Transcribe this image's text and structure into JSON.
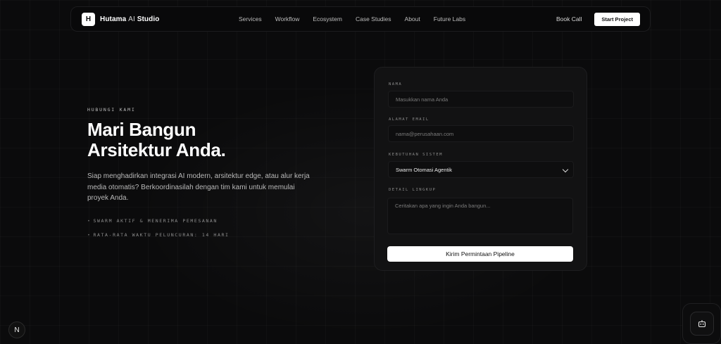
{
  "nav": {
    "logo_mark": "H",
    "logo_name_a": "Hutama",
    "logo_name_b": "AI",
    "logo_name_c": "Studio",
    "items": [
      "Services",
      "Workflow",
      "Ecosystem",
      "Case Studies",
      "About",
      "Future Labs"
    ],
    "book_call": "Book Call",
    "start_project": "Start Project"
  },
  "hero": {
    "eyebrow": "HUBUNGI KAMI",
    "headline_line1": "Mari Bangun",
    "headline_line2": "Arsitektur Anda.",
    "lead": "Siap menghadirkan integrasi AI modern, arsitektur edge, atau alur kerja media otomatis? Berkoordinasilah dengan tim kami untuk memulai proyek Anda.",
    "stats": [
      "SWARM AKTIF & MENERIMA PEMESANAN",
      "RATA-RATA WAKTU PELUNCURAN: 14 HARI"
    ]
  },
  "form": {
    "name_label": "NAMA",
    "name_placeholder": "Masukkan nama Anda",
    "email_label": "ALAMAT EMAIL",
    "email_placeholder": "nama@perusahaan.com",
    "system_label": "KEBUTUHAN SISTEM",
    "system_value": "Swarm Otomasi Agentik",
    "scope_label": "DETAIL LINGKUP",
    "scope_placeholder": "Ceritakan apa yang ingin Anda bangun...",
    "submit_label": "Kirim Permintaan Pipeline"
  },
  "corner": {
    "n_badge": "N"
  },
  "colors": {
    "background": "#0b0b0c",
    "panel": "#121213",
    "accent": "#ffffff"
  }
}
